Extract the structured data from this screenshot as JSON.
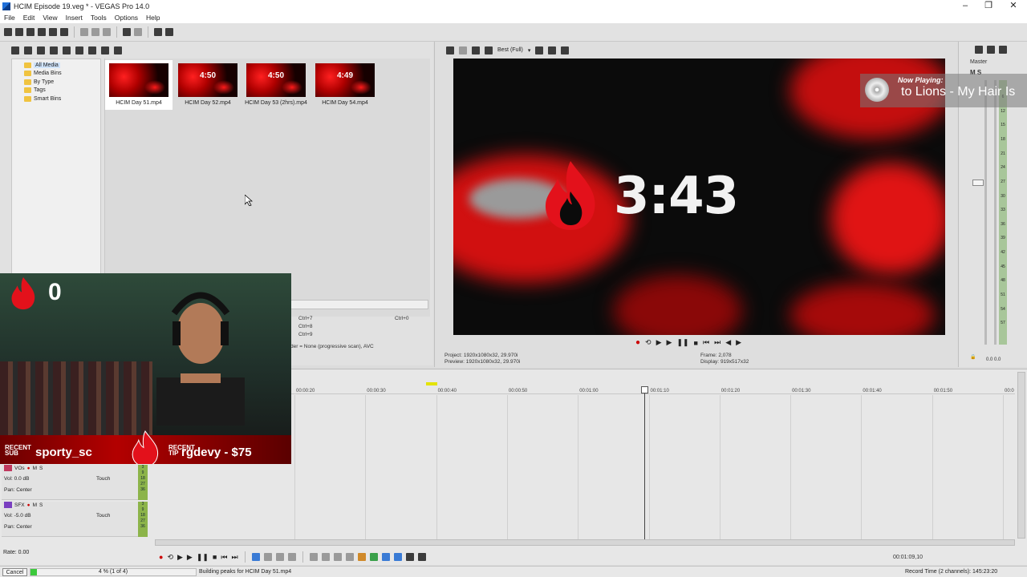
{
  "window": {
    "title": "HCIM Episode 19.veg * - VEGAS Pro 14.0"
  },
  "menu": [
    "File",
    "Edit",
    "View",
    "Insert",
    "Tools",
    "Options",
    "Help"
  ],
  "media_tree": {
    "items": [
      {
        "label": "All Media"
      },
      {
        "label": "Media Bins"
      },
      {
        "label": "By Type"
      },
      {
        "label": "Tags"
      },
      {
        "label": "Smart Bins"
      }
    ]
  },
  "media_files": [
    {
      "name": "HCIM Day 51.mp4",
      "overlay": ""
    },
    {
      "name": "HCIM Day 52.mp4",
      "overlay": "4:50"
    },
    {
      "name": "HCIM Day 53 (2hrs).mp4",
      "overlay": "4:50"
    },
    {
      "name": "HCIM Day 54.mp4",
      "overlay": "4:49"
    }
  ],
  "media_info": {
    "shortcuts": [
      "Ctrl+7",
      "Ctrl+8",
      "Ctrl+9"
    ],
    "shortcut_right": "Ctrl+0",
    "format": "der = None (progressive scan), AVC"
  },
  "preview": {
    "quality": "Best (Full)",
    "timer": "3:43",
    "project": "Project:  1920x1080x32, 29.970i",
    "preview": "Preview:  1920x1080x32, 29.970i",
    "frame": "Frame:     2,078",
    "display": "Display:",
    "display_val": "919x517x32"
  },
  "now_playing": {
    "label": "Now Playing:",
    "song": "to Lions - My Hair Is"
  },
  "master": {
    "label": "Master",
    "ms": "M S",
    "scale": [
      "6",
      "12",
      "15",
      "18",
      "21",
      "24",
      "27",
      "30",
      "33",
      "36",
      "39",
      "42",
      "45",
      "48",
      "51",
      "54",
      "57"
    ],
    "foot": "0.0  0.0"
  },
  "webcam": {
    "counter": "0",
    "recent_sub": "RECENT SUB",
    "sub_name": "sporty_sc",
    "recent_tip": "RECENT TIP",
    "tip_name": "rgdevy - $75"
  },
  "timeline": {
    "ticks": [
      "00:00:20",
      "00:00:30",
      "00:00:40",
      "00:00:50",
      "00:01:00",
      "00:01:10",
      "00:01:20",
      "00:01:30",
      "00:01:40",
      "00:01:50",
      "00:0"
    ],
    "tracks": [
      {
        "name": "VOs",
        "vol_label": "Vol:",
        "vol": "0.0 dB",
        "pan_label": "Pan:",
        "pan": "Center",
        "mode": "Touch",
        "color": "#c0395e"
      },
      {
        "name": "SFX",
        "vol_label": "Vol:",
        "vol": "-5.0 dB",
        "pan_label": "Pan:",
        "pan": "Center",
        "mode": "Touch",
        "color": "#7a3fc0"
      }
    ],
    "meter": [
      "3",
      "9",
      "18",
      "27",
      "36"
    ],
    "timecode": "00:01:09,10"
  },
  "rate": "Rate: 0.00",
  "status": {
    "cancel": "Cancel",
    "progress_text": "4 % (1 of 4)",
    "progress": 0.04,
    "message": "Building peaks for HCIM Day 51.mp4",
    "record_time": "Record Time (2 channels):  145:23:20"
  }
}
